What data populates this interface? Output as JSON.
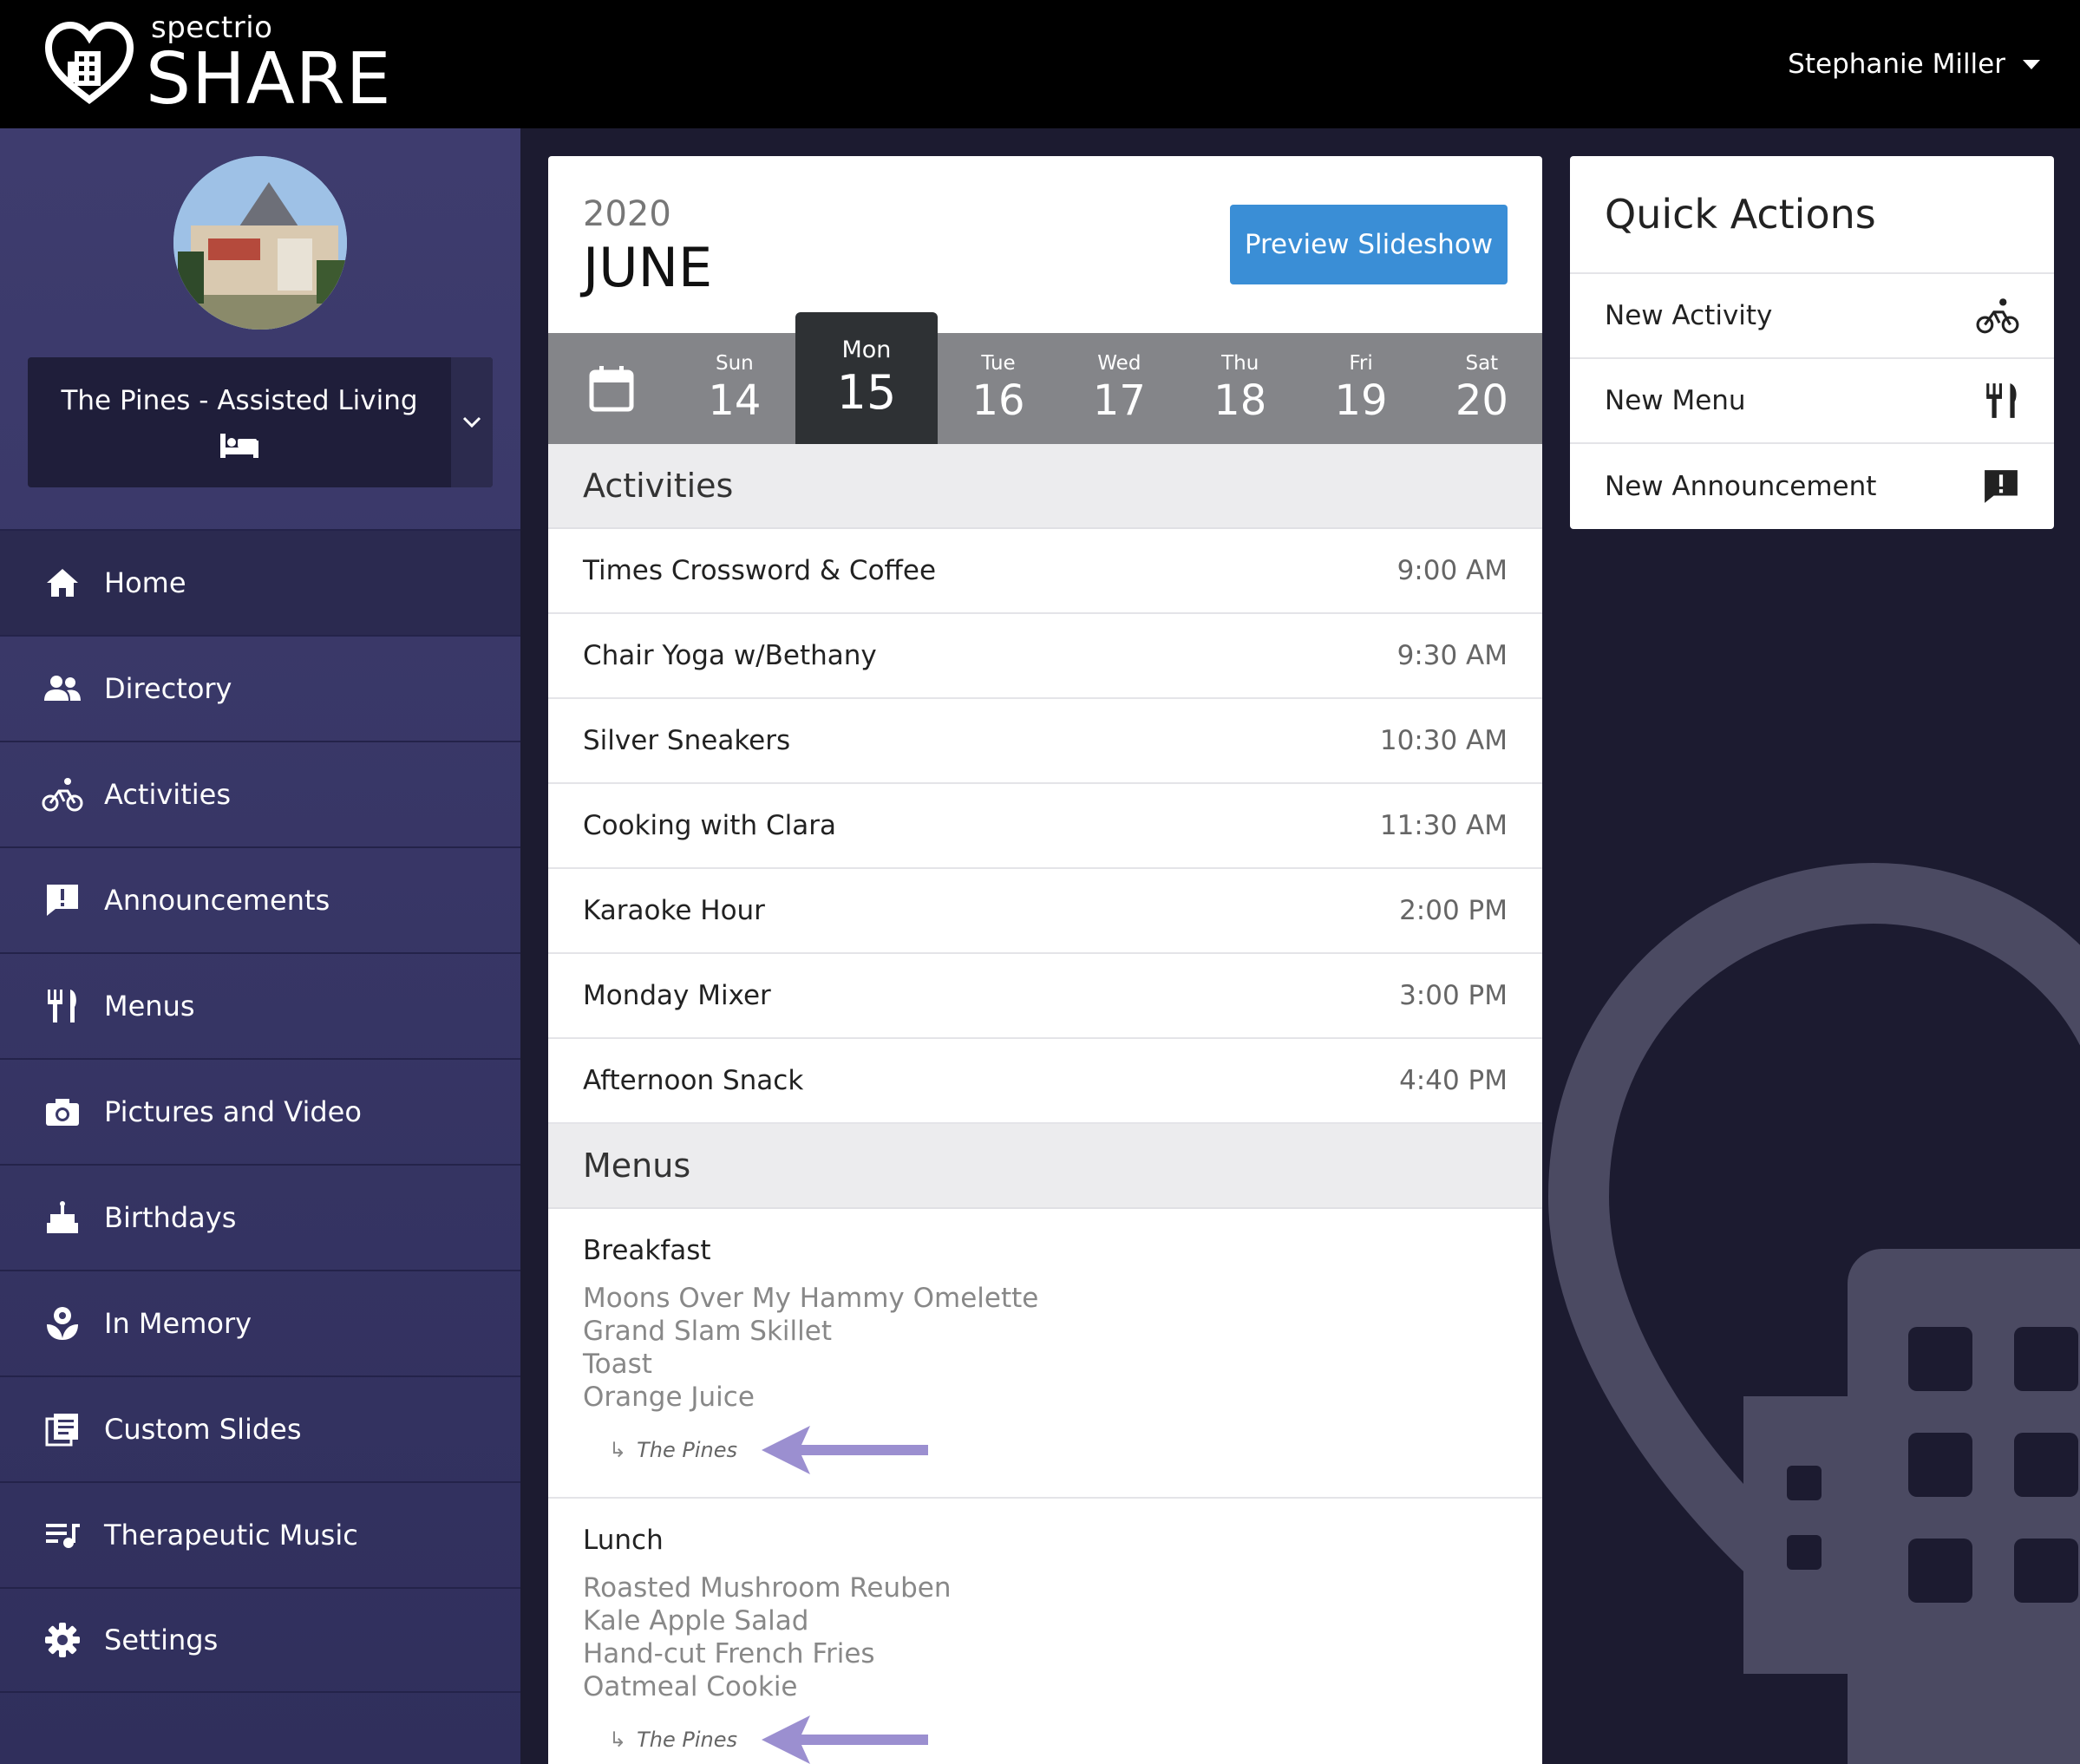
{
  "brand": {
    "small": "spectrio",
    "big": "SHARE"
  },
  "user": {
    "name": "Stephanie Miller"
  },
  "facility": {
    "name": "The Pines - Assisted Living"
  },
  "nav": [
    {
      "label": "Home",
      "icon": "home-icon"
    },
    {
      "label": "Directory",
      "icon": "people-icon"
    },
    {
      "label": "Activities",
      "icon": "bicycle-icon"
    },
    {
      "label": "Announcements",
      "icon": "announcement-icon"
    },
    {
      "label": "Menus",
      "icon": "utensils-icon"
    },
    {
      "label": "Pictures and Video",
      "icon": "camera-icon"
    },
    {
      "label": "Birthdays",
      "icon": "cake-icon"
    },
    {
      "label": "In Memory",
      "icon": "memorial-icon"
    },
    {
      "label": "Custom Slides",
      "icon": "slides-icon"
    },
    {
      "label": "Therapeutic Music",
      "icon": "music-icon"
    },
    {
      "label": "Settings",
      "icon": "gear-icon"
    }
  ],
  "calendar": {
    "year": "2020",
    "month": "JUNE",
    "preview_label": "Preview Slideshow",
    "days": [
      {
        "name": "Sun",
        "num": "14"
      },
      {
        "name": "Mon",
        "num": "15"
      },
      {
        "name": "Tue",
        "num": "16"
      },
      {
        "name": "Wed",
        "num": "17"
      },
      {
        "name": "Thu",
        "num": "18"
      },
      {
        "name": "Fri",
        "num": "19"
      },
      {
        "name": "Sat",
        "num": "20"
      }
    ]
  },
  "activities": {
    "heading": "Activities",
    "items": [
      {
        "name": "Times Crossword & Coffee",
        "time": "9:00 AM"
      },
      {
        "name": "Chair Yoga w/Bethany",
        "time": "9:30 AM"
      },
      {
        "name": "Silver Sneakers",
        "time": "10:30 AM"
      },
      {
        "name": "Cooking with Clara",
        "time": "11:30 AM"
      },
      {
        "name": "Karaoke Hour",
        "time": "2:00 PM"
      },
      {
        "name": "Monday Mixer",
        "time": "3:00 PM"
      },
      {
        "name": "Afternoon Snack",
        "time": "4:40 PM"
      }
    ]
  },
  "menus": {
    "heading": "Menus",
    "meals": [
      {
        "title": "Breakfast",
        "items": [
          "Moons Over My Hammy Omelette",
          "Grand Slam Skillet",
          "Toast",
          "Orange Juice"
        ],
        "source": "The Pines"
      },
      {
        "title": "Lunch",
        "items": [
          "Roasted Mushroom Reuben",
          "Kale Apple Salad",
          "Hand-cut French Fries",
          "Oatmeal Cookie"
        ],
        "source": "The Pines"
      }
    ]
  },
  "quick_actions": {
    "title": "Quick Actions",
    "items": [
      {
        "label": "New Activity",
        "icon": "bicycle-icon"
      },
      {
        "label": "New Menu",
        "icon": "utensils-icon"
      },
      {
        "label": "New Announcement",
        "icon": "announcement-icon"
      }
    ]
  },
  "colors": {
    "accent": "#3a8ed6",
    "sidebar": "#3e3c6e",
    "arrow": "#9b8fd0",
    "selected_day": "#2e3134"
  }
}
